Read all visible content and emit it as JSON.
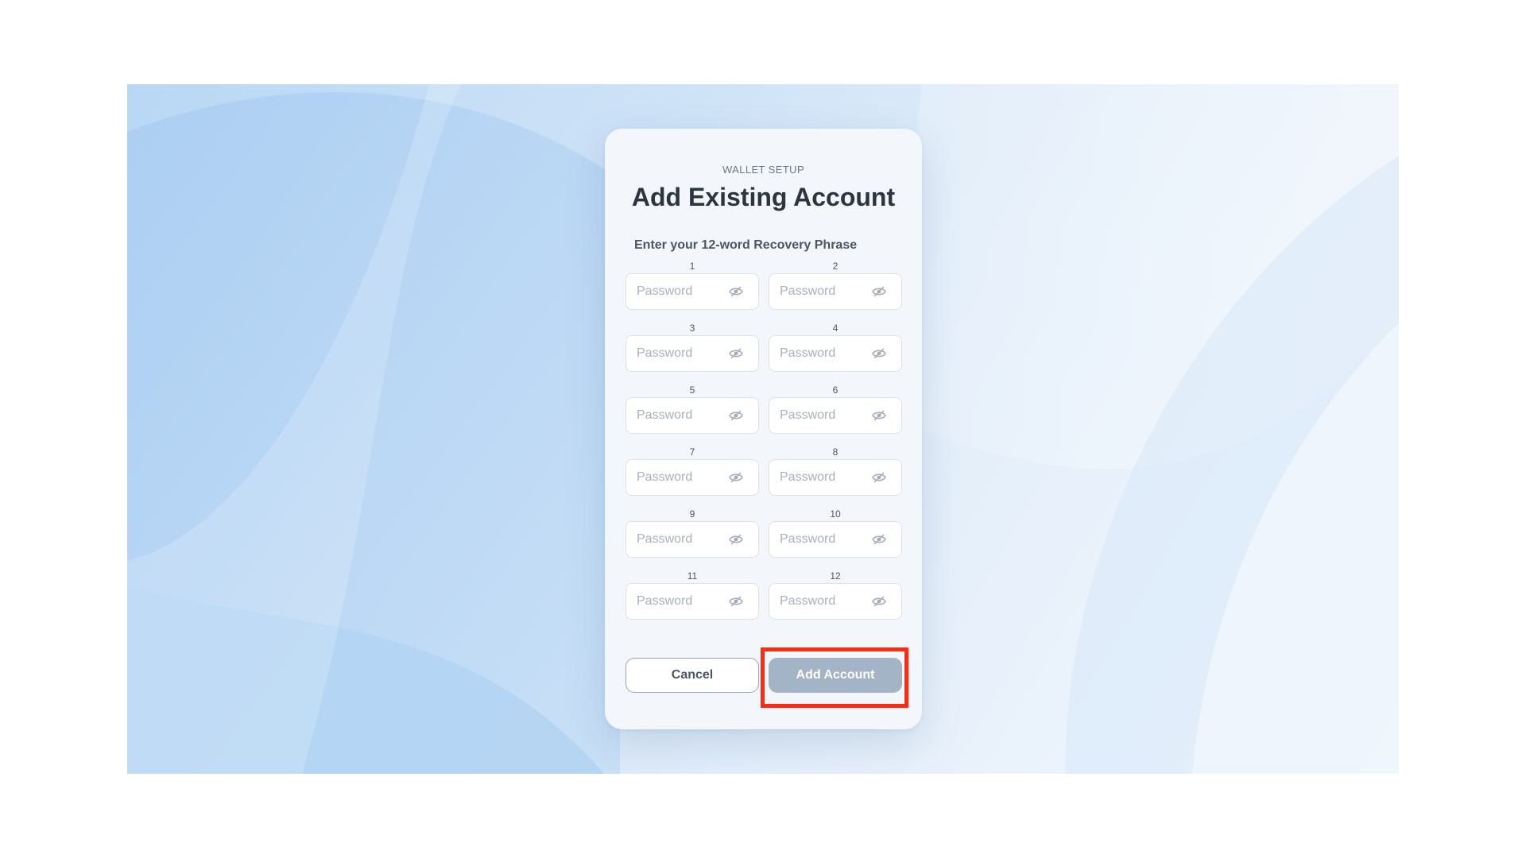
{
  "app": {
    "eyebrow": "WALLET SETUP",
    "title": "Add Existing Account",
    "subtitle": "Enter your 12-word Recovery Phrase"
  },
  "phrase_fields": [
    {
      "number": "1",
      "placeholder": "Password",
      "value": ""
    },
    {
      "number": "2",
      "placeholder": "Password",
      "value": ""
    },
    {
      "number": "3",
      "placeholder": "Password",
      "value": ""
    },
    {
      "number": "4",
      "placeholder": "Password",
      "value": ""
    },
    {
      "number": "5",
      "placeholder": "Password",
      "value": ""
    },
    {
      "number": "6",
      "placeholder": "Password",
      "value": ""
    },
    {
      "number": "7",
      "placeholder": "Password",
      "value": ""
    },
    {
      "number": "8",
      "placeholder": "Password",
      "value": ""
    },
    {
      "number": "9",
      "placeholder": "Password",
      "value": ""
    },
    {
      "number": "10",
      "placeholder": "Password",
      "value": ""
    },
    {
      "number": "11",
      "placeholder": "Password",
      "value": ""
    },
    {
      "number": "12",
      "placeholder": "Password",
      "value": ""
    }
  ],
  "field_icon": "eye-icon",
  "buttons": {
    "cancel_label": "Cancel",
    "add_label": "Add Account"
  },
  "colors": {
    "primary_button_disabled": "#a3b4c6",
    "highlight": "#ff2a12",
    "title_text": "#2c353f"
  }
}
